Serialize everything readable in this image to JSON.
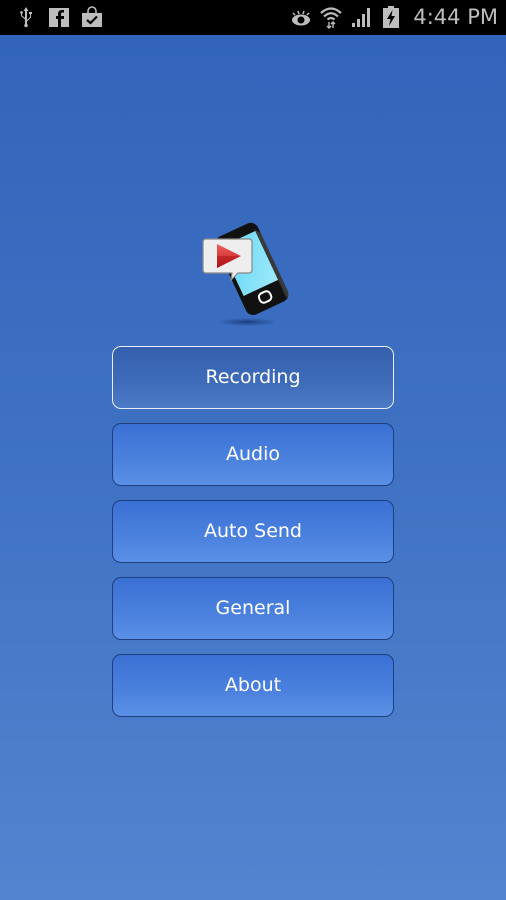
{
  "status_bar": {
    "left_icons": [
      "usb-icon",
      "facebook-icon",
      "shopping-bag-check-icon"
    ],
    "right_icons": [
      "eye-icon",
      "wifi-icon",
      "signal-icon",
      "battery-charging-icon"
    ],
    "time": "4:44 PM"
  },
  "app": {
    "logo": "phone-with-play-bubble-icon",
    "menu": [
      {
        "label": "Recording",
        "selected": true
      },
      {
        "label": "Audio",
        "selected": false
      },
      {
        "label": "Auto Send",
        "selected": false
      },
      {
        "label": "General",
        "selected": false
      },
      {
        "label": "About",
        "selected": false
      }
    ]
  },
  "colors": {
    "background_top": "#3264bb",
    "background_bottom": "#5284d0",
    "button": "#4a80dd",
    "button_selected": "#3e6bb9"
  }
}
